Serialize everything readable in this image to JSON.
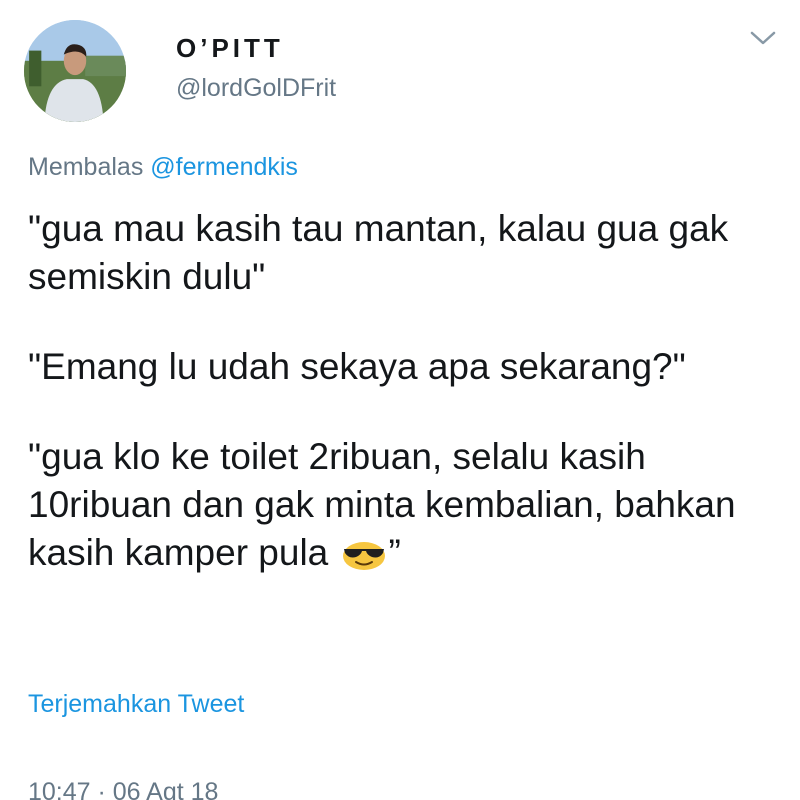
{
  "header": {
    "display_name": "O’PITT",
    "handle": "@lordGolDFrit",
    "avatar_icon": "profile-photo",
    "menu_icon": "chevron-down-icon"
  },
  "reply": {
    "prefix": "Membalas",
    "mention": "@fermendkis"
  },
  "tweet": {
    "paragraphs": [
      "\"gua mau kasih tau mantan, kalau gua gak semiskin dulu\"",
      "\"Emang lu udah sekaya apa sekarang?\"",
      "\"gua klo ke toilet 2ribuan, selalu kasih 10ribuan dan gak minta kembalian, bahkan kasih kamper pula"
    ],
    "trailing_quote": "”",
    "emoji_icon": "smiling-face-with-sunglasses-icon"
  },
  "actions": {
    "translate_label": "Terjemahkan Tweet"
  },
  "meta": {
    "timestamp": "10:47 · 06 Agt 18"
  },
  "colors": {
    "text": "#14171a",
    "secondary": "#657786",
    "link": "#1b95e0"
  }
}
